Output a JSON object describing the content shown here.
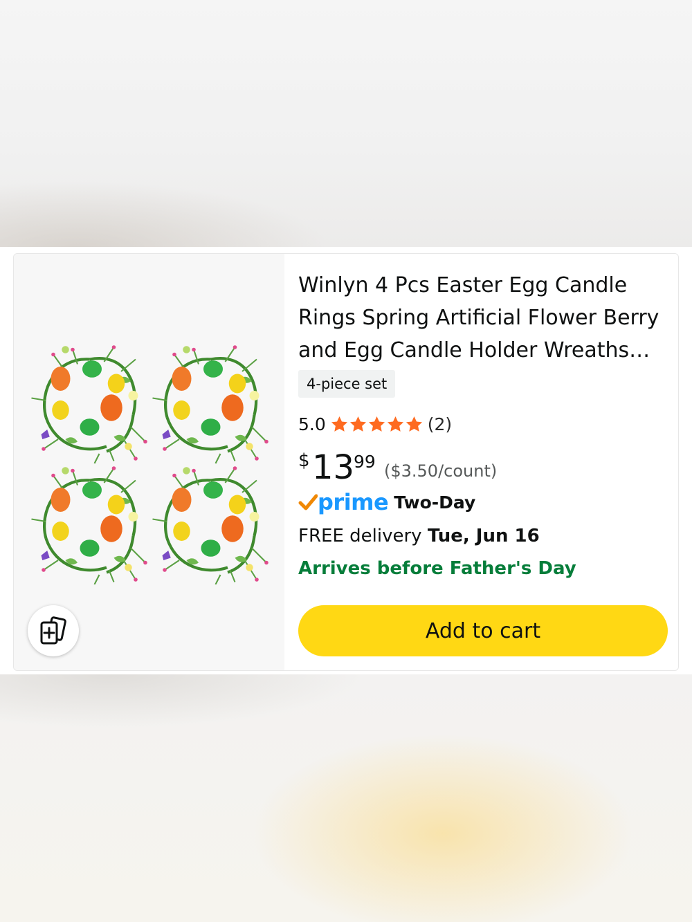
{
  "product": {
    "title_line1": "Winlyn 4 Pcs Easter Egg Candle",
    "title_line2": "Rings Spring Artificial Flower Berry",
    "title_line3": "and Egg Candle Holder Wreaths…",
    "variant": "4-piece set",
    "rating": "5.0",
    "rating_stars": 5,
    "rating_count": "(2)",
    "price_currency": "$",
    "price_whole": "13",
    "price_fraction": "99",
    "unit_price": "($3.50/count)",
    "prime_label": "prime",
    "prime_speed": "Two-Day",
    "delivery_prefix": "FREE delivery",
    "delivery_date": "Tue, Jun 16",
    "arrival_note": "Arrives before Father's Day",
    "add_to_cart_label": "Add to cart",
    "image_icon": "easter-egg-wreaths-image",
    "compare_icon": "compare-cards-icon"
  },
  "colors": {
    "cart_button": "#ffd814",
    "prime_blue": "#1a98ff",
    "prime_check": "#f08804",
    "arrival_green": "#067d3a",
    "star_orange": "#fe6b21"
  }
}
